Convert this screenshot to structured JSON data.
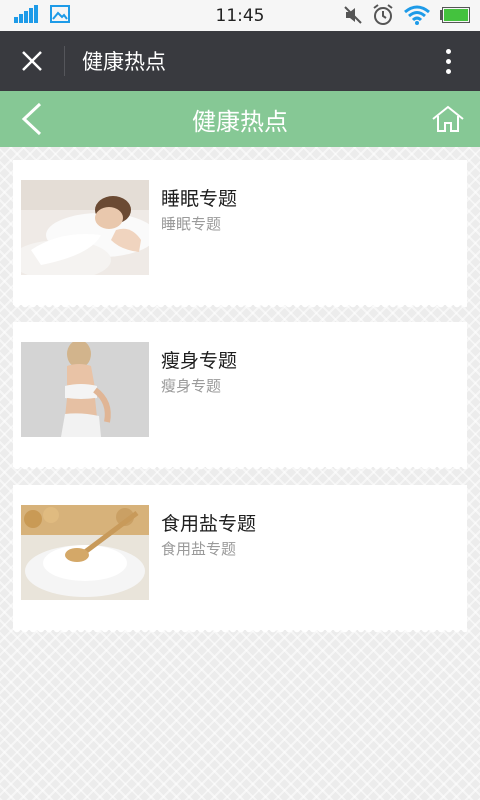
{
  "status_bar": {
    "time": "11:45",
    "icons": [
      "signal-icon",
      "image-icon",
      "mute-icon",
      "alarm-icon",
      "wifi-icon",
      "battery-icon"
    ]
  },
  "titlebar": {
    "title": "健康热点"
  },
  "header": {
    "title": "健康热点"
  },
  "topics": [
    {
      "title": "睡眠专题",
      "subtitle": "睡眠专题"
    },
    {
      "title": "瘦身专题",
      "subtitle": "瘦身专题"
    },
    {
      "title": "食用盐专题",
      "subtitle": "食用盐专题"
    }
  ],
  "colors": {
    "status_bar": "#f6f6f6",
    "titlebar": "#393a3f",
    "header": "#86c895",
    "accent_blue": "#1e9be8"
  }
}
